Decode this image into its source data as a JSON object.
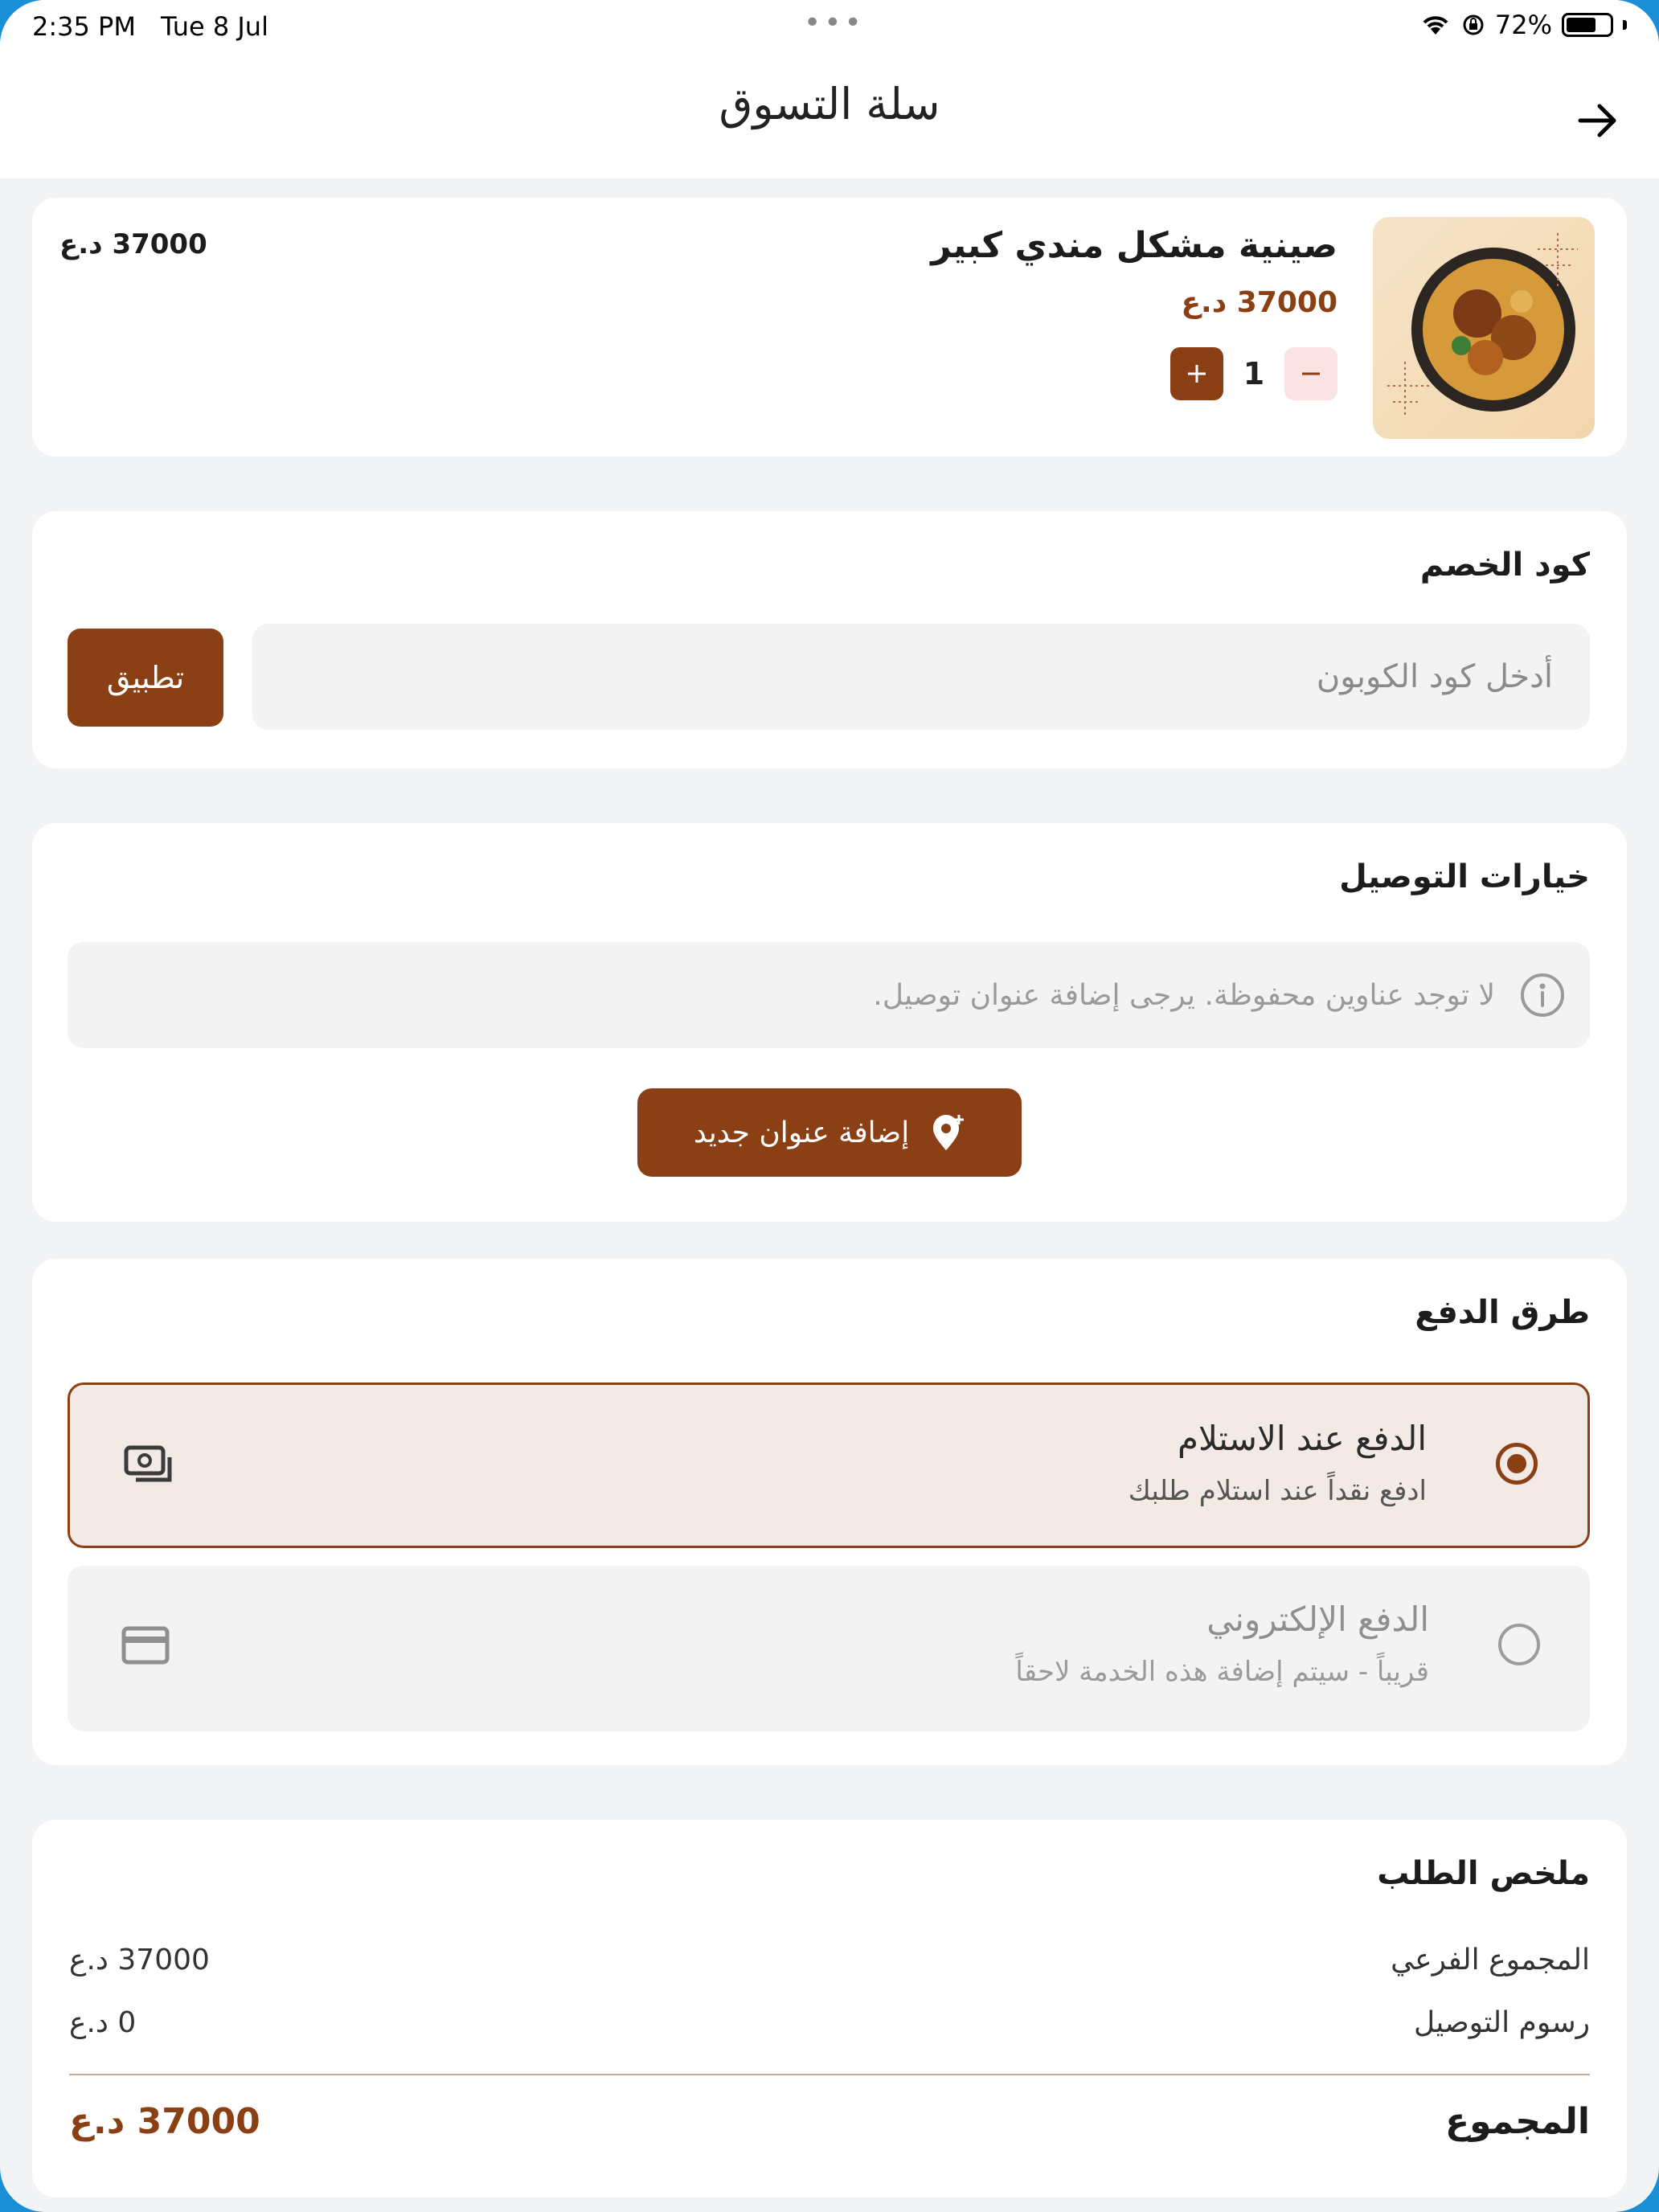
{
  "status_bar": {
    "time": "2:35 PM",
    "date": "Tue 8 Jul",
    "battery": "72%",
    "battery_level": 0.72
  },
  "header": {
    "title": "سلة التسوق"
  },
  "cart_item": {
    "name": "صينية مشكل مندي كبير",
    "price": "37000 د.ع",
    "total": "37000 د.ع",
    "quantity": "1"
  },
  "coupon": {
    "title": "كود الخصم",
    "placeholder": "أدخل كود الكوبون",
    "apply_label": "تطبيق"
  },
  "delivery": {
    "title": "خيارات التوصيل",
    "empty_message": "لا توجد عناوين محفوظة. يرجى إضافة عنوان توصيل.",
    "add_address_label": "إضافة عنوان جديد"
  },
  "payment": {
    "title": "طرق الدفع",
    "options": [
      {
        "title": "الدفع عند الاستلام",
        "subtitle": "ادفع نقداً عند استلام طلبك",
        "selected": true,
        "icon": "cash-icon"
      },
      {
        "title": "الدفع الإلكتروني",
        "subtitle": "قريباً - سيتم إضافة هذه الخدمة لاحقاً",
        "selected": false,
        "icon": "credit-card-icon"
      }
    ]
  },
  "summary": {
    "title": "ملخص الطلب",
    "subtotal_label": "المجموع الفرعي",
    "subtotal_value": "37000 د.ع",
    "delivery_label": "رسوم التوصيل",
    "delivery_value": "0 د.ع",
    "total_label": "المجموع",
    "total_value": "37000 د.ع"
  },
  "colors": {
    "accent": "#8b3f14",
    "background": "#f2f3f5",
    "selected_bg": "#f3e9e5"
  }
}
